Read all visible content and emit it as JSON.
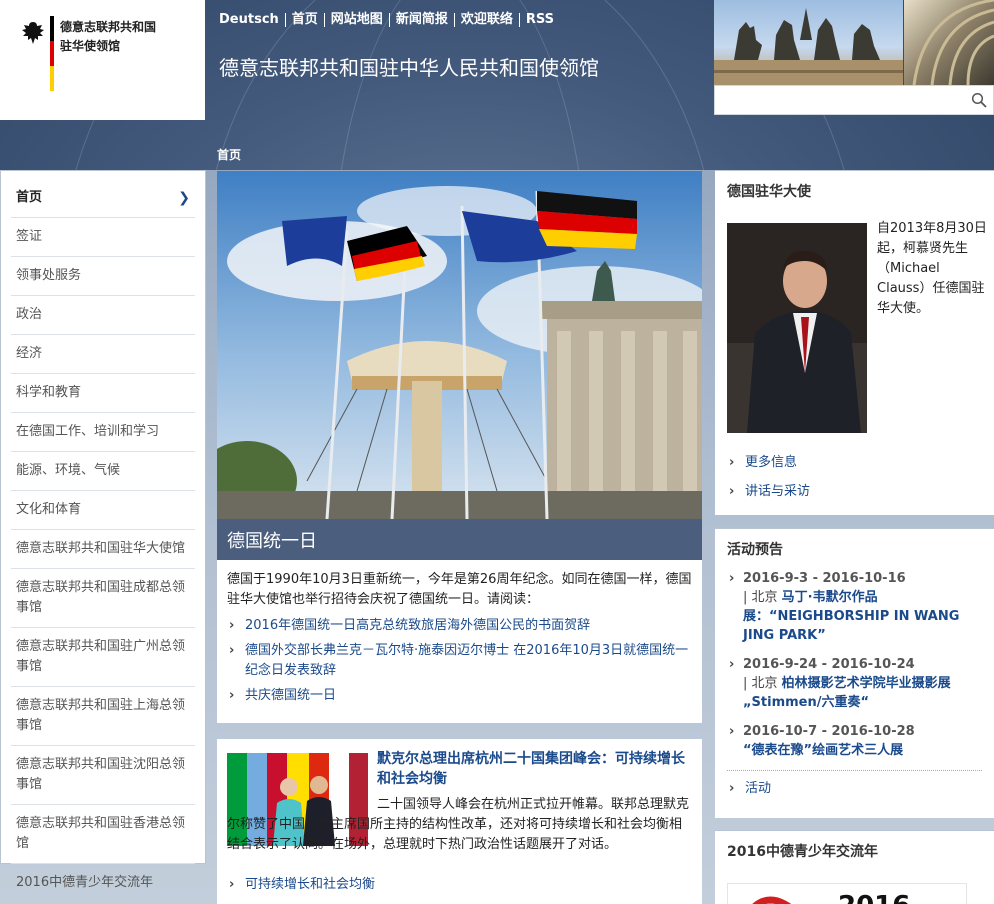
{
  "header": {
    "logo_line1": "德意志联邦共和国",
    "logo_line2": "驻华使领馆",
    "site_title": "德意志联邦共和国驻中华人民共和国使领馆",
    "nav": [
      "Deutsch",
      "首页",
      "网站地图",
      "新闻简报",
      "欢迎联络",
      "RSS"
    ],
    "search": {
      "placeholder": "",
      "icon": "search-icon"
    },
    "flag_colors": [
      "#000000",
      "#dd0000",
      "#ffce00"
    ]
  },
  "breadcrumb": "首页",
  "sidebar": {
    "items": [
      {
        "label": "首页",
        "active": true
      },
      {
        "label": "签证"
      },
      {
        "label": "领事处服务"
      },
      {
        "label": "政治"
      },
      {
        "label": "经济"
      },
      {
        "label": "科学和教育"
      },
      {
        "label": "在德国工作、培训和学习"
      },
      {
        "label": "能源、环境、气候"
      },
      {
        "label": "文化和体育"
      },
      {
        "label": "德意志联邦共和国驻华大使馆"
      },
      {
        "label": "德意志联邦共和国驻成都总领事馆"
      },
      {
        "label": "德意志联邦共和国驻广州总领事馆"
      },
      {
        "label": "德意志联邦共和国驻上海总领事馆"
      },
      {
        "label": "德意志联邦共和国驻沈阳总领事馆"
      },
      {
        "label": "德意志联邦共和国驻香港总领馆"
      },
      {
        "label": "2016中德青少年交流年"
      }
    ]
  },
  "main": {
    "hero_caption": "德国统一日",
    "intro": "德国于1990年10月3日重新统一，今年是第26周年纪念。如同在德国一样，德国驻华大使馆也举行招待会庆祝了德国统一日。请阅读：",
    "links": [
      "2016年德国统一日高克总统致旅居海外德国公民的书面贺辞",
      "德国外交部长弗兰克－瓦尔特·施泰因迈尔博士 在2016年10月3日就德国统一纪念日发表致辞",
      "共庆德国统一日"
    ],
    "news": {
      "headline": "默克尔总理出席杭州二十国集团峰会：可持续增长和社会均衡",
      "body": "二十国领导人峰会在杭州正式拉开帷幕。联邦总理默克尔称赞了中国作为主席国所主持的结构性改革，还对将可持续增长和社会均衡相结合表示了认同。在场外，总理就时下热门政治性话题展开了对话。",
      "link": "可持续增长和社会均衡"
    }
  },
  "right": {
    "ambassador": {
      "title": "德国驻华大使",
      "text": "自2013年8月30日起，柯慕贤先生（Michael Clauss）任德国驻华大使。",
      "links": [
        "更多信息",
        "讲话与采访"
      ]
    },
    "events": {
      "title": "活动预告",
      "items": [
        {
          "dates": "2016-9-3 - 2016-10-16",
          "city": "| 北京 ",
          "title": "马丁·韦默尔作品展：“NEIGHBORSHIP IN WANG JING PARK”"
        },
        {
          "dates": "2016-9-24 - 2016-10-24",
          "city": "| 北京 ",
          "title": "柏林摄影艺术学院毕业摄影展„Stimmen/六重奏“"
        },
        {
          "dates": "2016-10-7 - 2016-10-28",
          "city": "",
          "title": "“德表在豫”绘画艺术三人展"
        }
      ],
      "more_link": "活动"
    },
    "youth": {
      "title": "2016中德青少年交流年",
      "logo_text": "2016"
    }
  }
}
